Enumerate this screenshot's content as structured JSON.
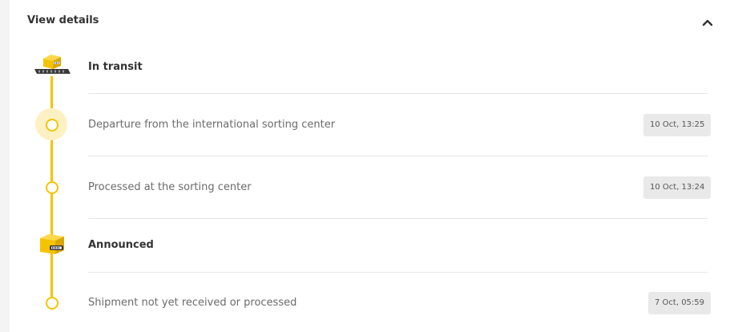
{
  "header": {
    "title": "View details",
    "toggle_icon": "chevron-up-icon"
  },
  "accent_color": "#f5c400",
  "groups": [
    {
      "title": "In transit",
      "icon": "parcel-on-conveyor-icon",
      "events": [
        {
          "text": "Departure from the international sorting center",
          "time": "10 Oct, 13:25",
          "current": true
        },
        {
          "text": "Processed at the sorting center",
          "time": "10 Oct, 13:24",
          "current": false
        }
      ]
    },
    {
      "title": "Announced",
      "icon": "parcel-with-label-icon",
      "events": [
        {
          "text": "Shipment not yet received or processed",
          "time": "7 Oct, 05:59",
          "current": false
        }
      ]
    }
  ]
}
